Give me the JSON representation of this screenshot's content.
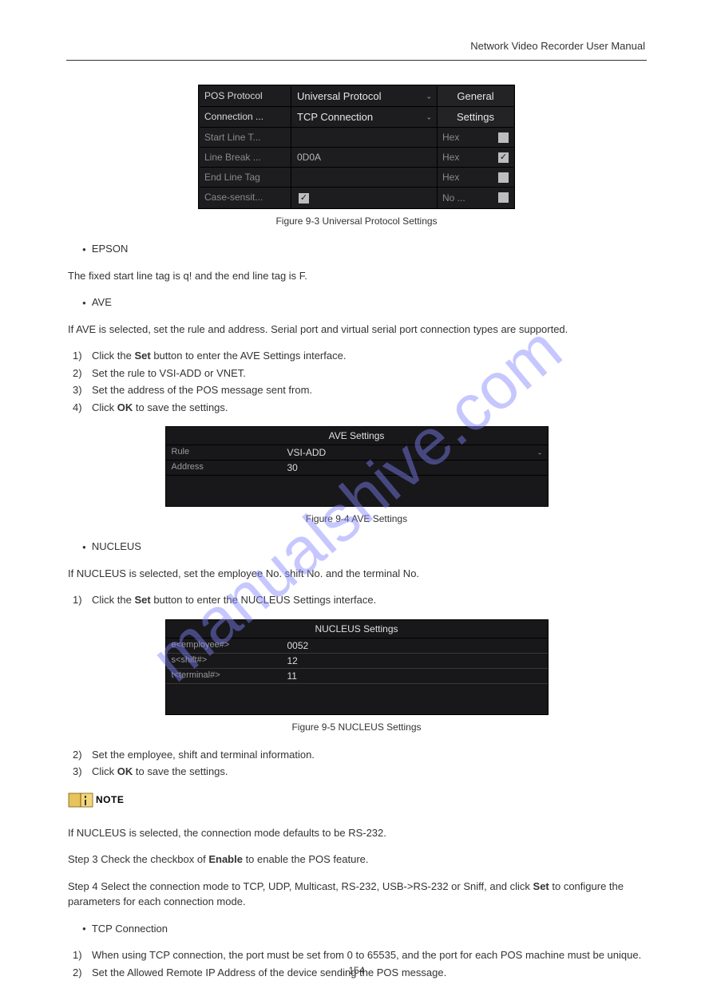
{
  "header": {
    "title": "Network Video Recorder User Manual"
  },
  "watermark": "manualshive.com",
  "fig1": {
    "rows": [
      {
        "label": "POS Protocol",
        "value": "Universal Protocol",
        "button": "General",
        "dropdown": true,
        "label_muted": false
      },
      {
        "label": "Connection ...",
        "value": "TCP Connection",
        "button": "Settings",
        "dropdown": true,
        "label_muted": false
      },
      {
        "label": "Start Line T...",
        "value": "",
        "side_label": "Hex",
        "side_checked": false,
        "label_muted": true
      },
      {
        "label": "Line Break ...",
        "value": "0D0A",
        "side_label": "Hex",
        "side_checked": true,
        "label_muted": true
      },
      {
        "label": "End Line Tag",
        "value": "",
        "side_label": "Hex",
        "side_checked": false,
        "label_muted": true
      },
      {
        "label": "Case-sensit...",
        "inline_checked": true,
        "side_label": "No ...",
        "side_checked": false,
        "label_muted": true
      }
    ],
    "caption": "Figure 9-3 Universal Protocol Settings"
  },
  "section_bullet": {
    "lead": "EPSON",
    "text": "The fixed start line tag is q! and the end line tag is F.",
    "sub_items": [
      "AVE",
      "NUCLEUS"
    ]
  },
  "ave_para": "If AVE is selected, set the rule and address. Serial port and virtual serial port connection types are supported.",
  "ave_steps": [
    {
      "n": "1)",
      "text_a": "Click the ",
      "bold": "Set",
      "text_b": " button to enter the AVE Settings interface."
    },
    {
      "n": "2)",
      "text": "Set the rule to VSI-ADD or VNET."
    },
    {
      "n": "3)",
      "text": "Set the address of the POS message sent from."
    },
    {
      "n": "4)",
      "text_a": "Click ",
      "bold": "OK",
      "text_b": " to save the settings."
    }
  ],
  "fig2": {
    "title": "AVE Settings",
    "rule_label": "Rule",
    "rule_value": "VSI-ADD",
    "addr_label": "Address",
    "addr_value": "30",
    "caption": "Figure 9-4 AVE Settings"
  },
  "nuc_para": "If NUCLEUS is selected, set the employee No. shift No. and the terminal No.",
  "nuc_steps": [
    {
      "n": "1)",
      "text_a": "Click the ",
      "bold": "Set",
      "text_b": " button to enter the NUCLEUS Settings interface."
    }
  ],
  "fig3": {
    "title": "NUCLEUS Settings",
    "emp_label": "e<employee#>",
    "emp_value": "0052",
    "shift_label": "s<shift#>",
    "shift_value": "12",
    "term_label": "t<terminal#>",
    "term_value": "11",
    "caption": "Figure 9-5 NUCLEUS Settings"
  },
  "nuc_steps2": [
    {
      "n": "2)",
      "text": "Set the employee, shift and terminal information."
    },
    {
      "n": "3)",
      "text_a": "Click ",
      "bold": "OK",
      "text_b": " to save the settings."
    }
  ],
  "note_label": "NOTE",
  "note_text": "If NUCLEUS is selected, the connection mode defaults to be RS-232.",
  "step3": {
    "lead": "Step 3 Check the checkbox of ",
    "bold": "Enable",
    "tail": " to enable the POS feature."
  },
  "step4": {
    "lead": "Step 4 Select the connection mode to TCP, UDP, Multicast, RS-232, USB->RS-232 or Sniff, and click ",
    "bold": "Set",
    "tail": " to configure the parameters for each connection mode."
  },
  "bullets2": [
    "TCP Connection"
  ],
  "tcp_steps": [
    {
      "n": "1)",
      "text": "When using TCP connection, the port must be set from 0 to 65535, and the port for each POS machine must be unique."
    },
    {
      "n": "2)",
      "text": "Set the Allowed Remote IP Address of the device sending the POS message."
    }
  ],
  "page_num": "154"
}
